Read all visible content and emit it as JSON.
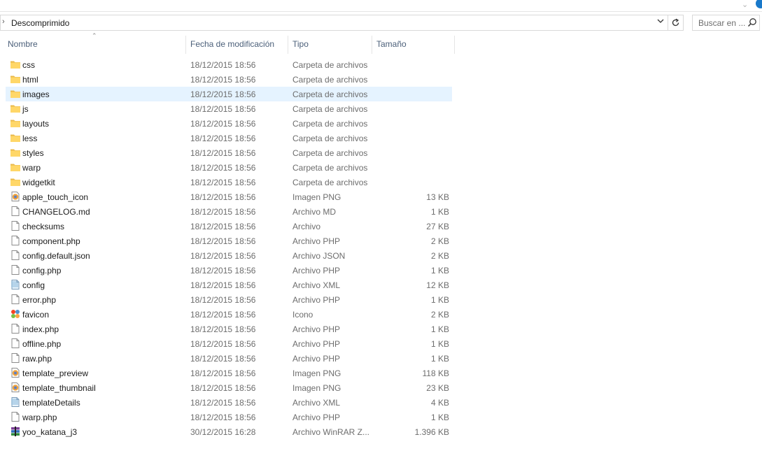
{
  "breadcrumb": {
    "current": "Descomprimido"
  },
  "search": {
    "placeholder": "Buscar en ..."
  },
  "columns": {
    "name": "Nombre",
    "date": "Fecha de modificación",
    "type": "Tipo",
    "size": "Tamaño"
  },
  "files": [
    {
      "name": "css",
      "date": "18/12/2015 18:56",
      "type": "Carpeta de archivos",
      "size": "",
      "icon": "folder-icon"
    },
    {
      "name": "html",
      "date": "18/12/2015 18:56",
      "type": "Carpeta de archivos",
      "size": "",
      "icon": "folder-icon"
    },
    {
      "name": "images",
      "date": "18/12/2015 18:56",
      "type": "Carpeta de archivos",
      "size": "",
      "icon": "folder-icon",
      "selected": true
    },
    {
      "name": "js",
      "date": "18/12/2015 18:56",
      "type": "Carpeta de archivos",
      "size": "",
      "icon": "folder-icon"
    },
    {
      "name": "layouts",
      "date": "18/12/2015 18:56",
      "type": "Carpeta de archivos",
      "size": "",
      "icon": "folder-icon"
    },
    {
      "name": "less",
      "date": "18/12/2015 18:56",
      "type": "Carpeta de archivos",
      "size": "",
      "icon": "folder-icon"
    },
    {
      "name": "styles",
      "date": "18/12/2015 18:56",
      "type": "Carpeta de archivos",
      "size": "",
      "icon": "folder-icon"
    },
    {
      "name": "warp",
      "date": "18/12/2015 18:56",
      "type": "Carpeta de archivos",
      "size": "",
      "icon": "folder-icon"
    },
    {
      "name": "widgetkit",
      "date": "18/12/2015 18:56",
      "type": "Carpeta de archivos",
      "size": "",
      "icon": "folder-icon"
    },
    {
      "name": "apple_touch_icon",
      "date": "18/12/2015 18:56",
      "type": "Imagen PNG",
      "size": "13 KB",
      "icon": "image-icon"
    },
    {
      "name": "CHANGELOG.md",
      "date": "18/12/2015 18:56",
      "type": "Archivo MD",
      "size": "1 KB",
      "icon": "file-icon"
    },
    {
      "name": "checksums",
      "date": "18/12/2015 18:56",
      "type": "Archivo",
      "size": "27 KB",
      "icon": "file-icon"
    },
    {
      "name": "component.php",
      "date": "18/12/2015 18:56",
      "type": "Archivo PHP",
      "size": "2 KB",
      "icon": "file-icon"
    },
    {
      "name": "config.default.json",
      "date": "18/12/2015 18:56",
      "type": "Archivo JSON",
      "size": "2 KB",
      "icon": "file-icon"
    },
    {
      "name": "config.php",
      "date": "18/12/2015 18:56",
      "type": "Archivo PHP",
      "size": "1 KB",
      "icon": "file-icon"
    },
    {
      "name": "config",
      "date": "18/12/2015 18:56",
      "type": "Archivo XML",
      "size": "12 KB",
      "icon": "xml-icon"
    },
    {
      "name": "error.php",
      "date": "18/12/2015 18:56",
      "type": "Archivo PHP",
      "size": "1 KB",
      "icon": "file-icon"
    },
    {
      "name": "favicon",
      "date": "18/12/2015 18:56",
      "type": "Icono",
      "size": "2 KB",
      "icon": "favicon-icon"
    },
    {
      "name": "index.php",
      "date": "18/12/2015 18:56",
      "type": "Archivo PHP",
      "size": "1 KB",
      "icon": "file-icon"
    },
    {
      "name": "offline.php",
      "date": "18/12/2015 18:56",
      "type": "Archivo PHP",
      "size": "1 KB",
      "icon": "file-icon"
    },
    {
      "name": "raw.php",
      "date": "18/12/2015 18:56",
      "type": "Archivo PHP",
      "size": "1 KB",
      "icon": "file-icon"
    },
    {
      "name": "template_preview",
      "date": "18/12/2015 18:56",
      "type": "Imagen PNG",
      "size": "118 KB",
      "icon": "image-icon"
    },
    {
      "name": "template_thumbnail",
      "date": "18/12/2015 18:56",
      "type": "Imagen PNG",
      "size": "23 KB",
      "icon": "image-icon"
    },
    {
      "name": "templateDetails",
      "date": "18/12/2015 18:56",
      "type": "Archivo XML",
      "size": "4 KB",
      "icon": "xml-icon"
    },
    {
      "name": "warp.php",
      "date": "18/12/2015 18:56",
      "type": "Archivo PHP",
      "size": "1 KB",
      "icon": "file-icon"
    },
    {
      "name": "yoo_katana_j3",
      "date": "30/12/2015 16:28",
      "type": "Archivo WinRAR Z...",
      "size": "1.396 KB",
      "icon": "winrar-icon"
    }
  ],
  "colors": {
    "selection": "#e5f3ff",
    "header_text": "#4c607a",
    "folder": "#ffd768",
    "accent": "#1979ca"
  }
}
